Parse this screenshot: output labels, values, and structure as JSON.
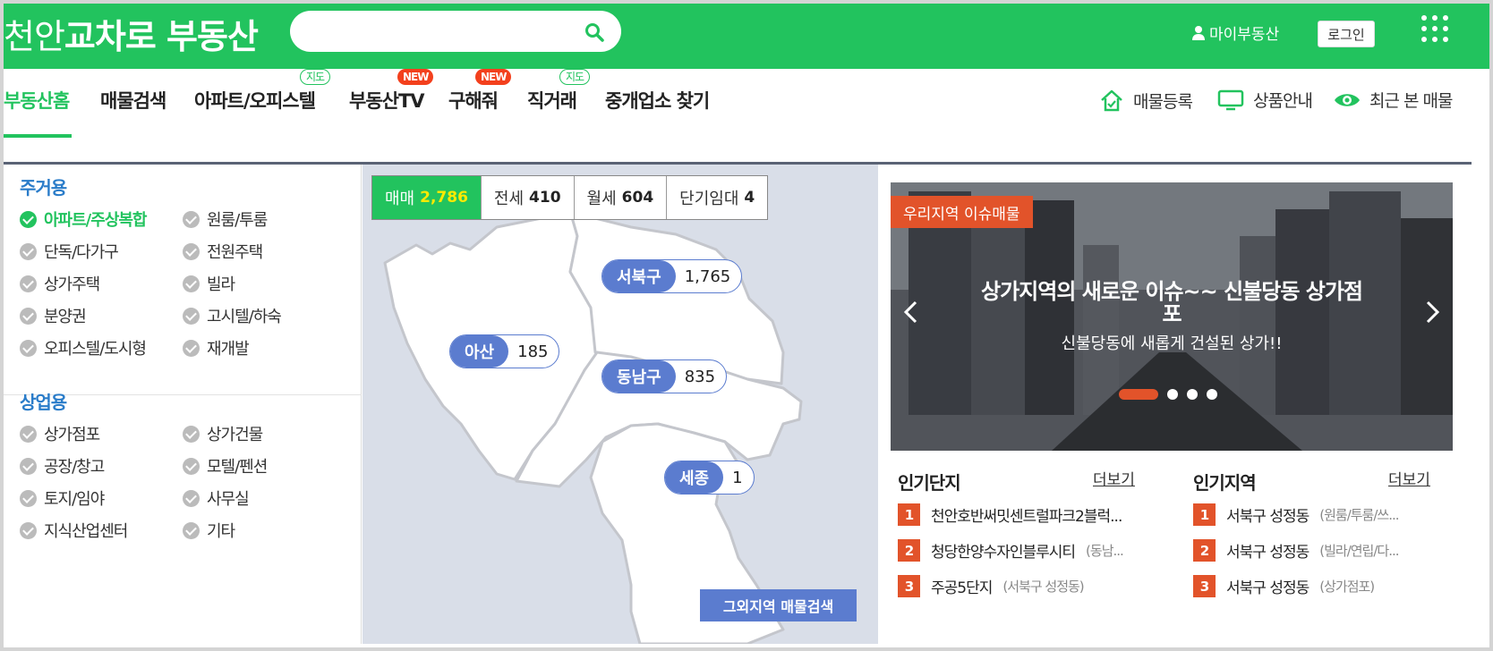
{
  "header": {
    "logo_part1": "천안",
    "logo_part2": "교차로 부동산",
    "search_placeholder": "",
    "my_label": "마이부동산",
    "login_label": "로그인"
  },
  "gnb": {
    "tabs": [
      {
        "label": "부동산홈",
        "badge": ""
      },
      {
        "label": "매물검색",
        "badge": ""
      },
      {
        "label": "아파트/오피스텔",
        "badge": "지도"
      },
      {
        "label": "부동산TV",
        "badge": "NEW"
      },
      {
        "label": "구해줘",
        "badge": "NEW"
      },
      {
        "label": "직거래",
        "badge": "지도"
      },
      {
        "label": "중개업소 찾기",
        "badge": ""
      }
    ],
    "utils": [
      "매물등록",
      "상품안내",
      "최근 본 매물"
    ]
  },
  "categories": {
    "residential_title": "주거용",
    "residential": [
      "아파트/주상복합",
      "원룸/투룸",
      "단독/다가구",
      "전원주택",
      "상가주택",
      "빌라",
      "분양권",
      "고시텔/하숙",
      "오피스텔/도시형",
      "재개발"
    ],
    "commercial_title": "상업용",
    "commercial": [
      "상가점포",
      "상가건물",
      "공장/창고",
      "모텔/펜션",
      "토지/임야",
      "사무실",
      "지식산업센터",
      "기타"
    ]
  },
  "map": {
    "deals": [
      {
        "label": "매매",
        "count": "2,786"
      },
      {
        "label": "전세",
        "count": "410"
      },
      {
        "label": "월세",
        "count": "604"
      },
      {
        "label": "단기임대",
        "count": "4"
      }
    ],
    "regions": [
      {
        "name": "서북구",
        "count": "1,765"
      },
      {
        "name": "아산",
        "count": "185"
      },
      {
        "name": "동남구",
        "count": "835"
      },
      {
        "name": "세종",
        "count": "1"
      }
    ],
    "other_button": "그외지역 매물검색"
  },
  "banner": {
    "tag": "우리지역 이슈매물",
    "title_line1": "상가지역의 새로운 이슈~~ 신불당동 상가점",
    "title_line2": "포",
    "subtitle": "신불당동에 새롭게 건설된 상가!!",
    "slide_count": 4,
    "active_slide": 1
  },
  "popular_complex": {
    "title": "인기단지",
    "more": "더보기",
    "items": [
      {
        "rank": "1",
        "name": "천안호반써밋센트럴파크2블럭...",
        "sub": ""
      },
      {
        "rank": "2",
        "name": "청당한양수자인블루시티",
        "sub": "(동남..."
      },
      {
        "rank": "3",
        "name": "주공5단지",
        "sub": "(서북구 성정동)"
      }
    ]
  },
  "popular_region": {
    "title": "인기지역",
    "more": "더보기",
    "items": [
      {
        "rank": "1",
        "name": "서북구 성정동",
        "sub": "(원룸/투룸/쓰..."
      },
      {
        "rank": "2",
        "name": "서북구 성정동",
        "sub": "(빌라/연립/다..."
      },
      {
        "rank": "3",
        "name": "서북구 성정동",
        "sub": "(상가점포)"
      }
    ]
  },
  "colors": {
    "brand_green": "#22c35e",
    "accent_blue": "#5b7ccf",
    "accent_orange": "#e2532a",
    "badge_red": "#f3401d",
    "title_blue": "#2a7cc9"
  }
}
